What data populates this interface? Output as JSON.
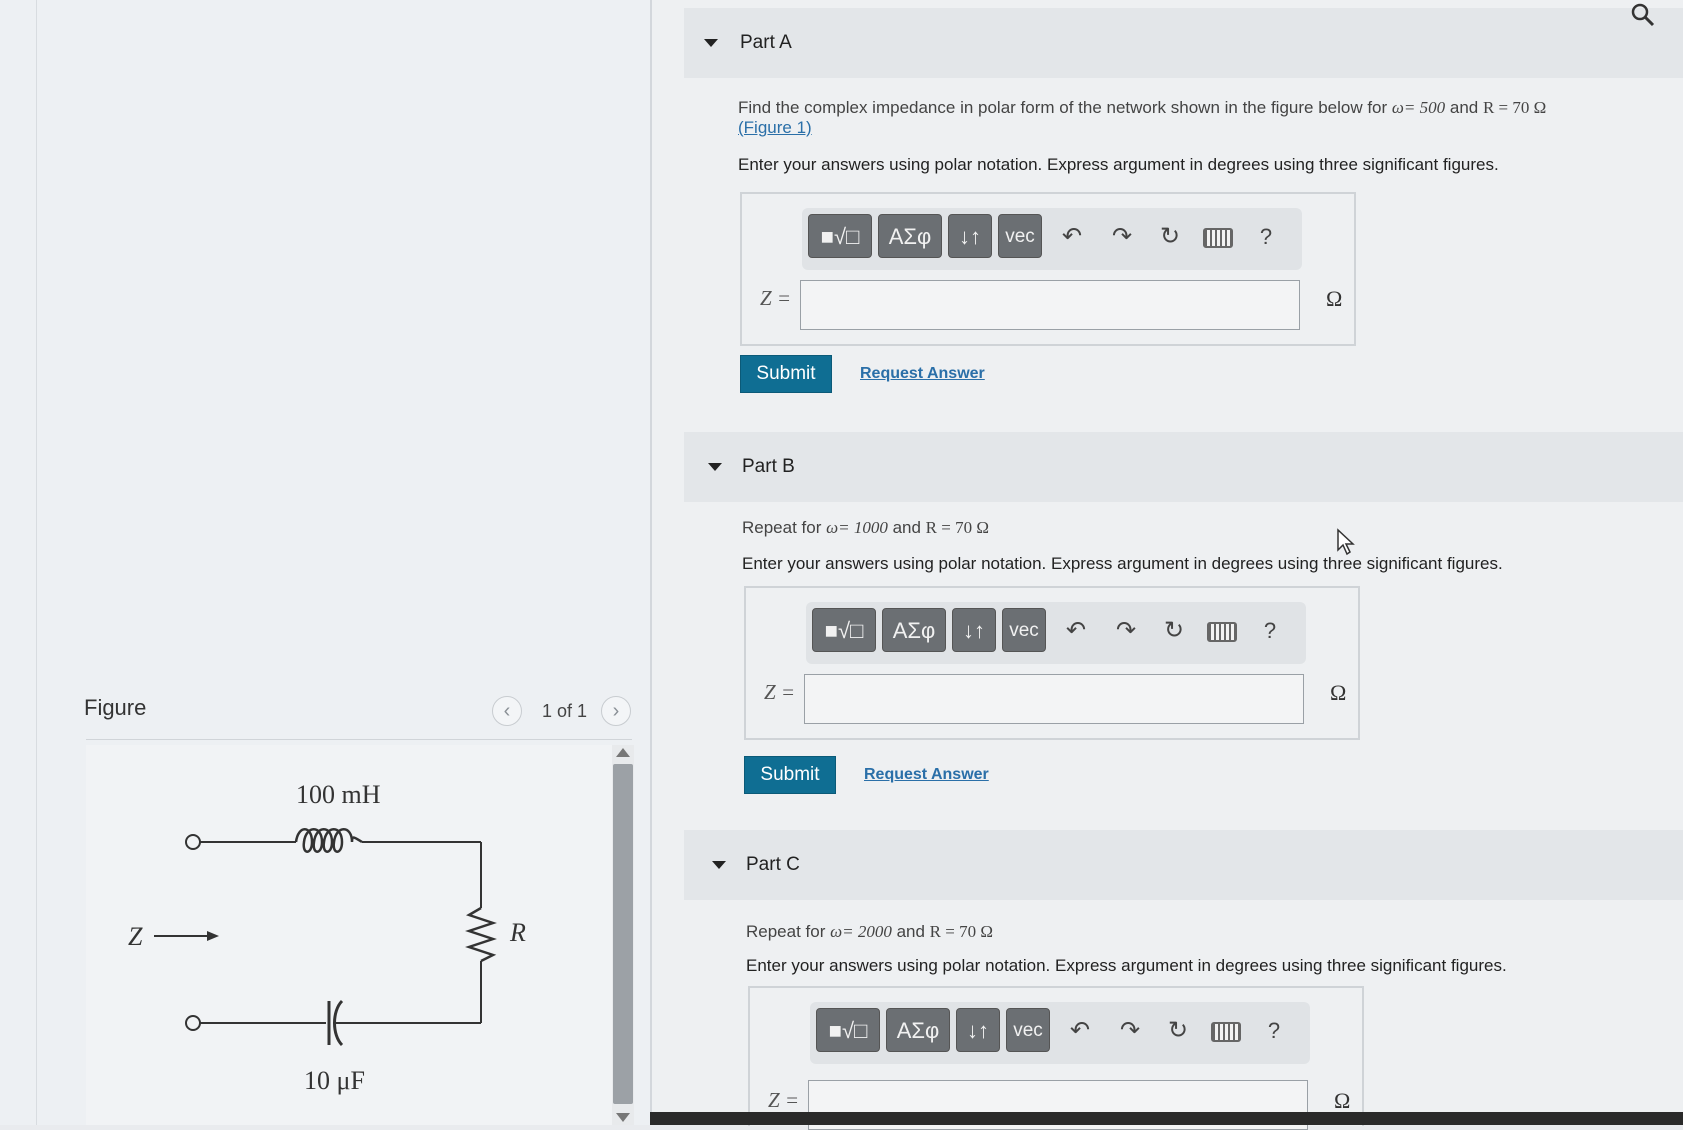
{
  "figure": {
    "label": "Figure",
    "counter": "1 of 1",
    "prev_icon": "‹",
    "next_icon": "›",
    "circuit": {
      "inductor_label": "100 mH",
      "capacitor_label": "10 μF",
      "resistor_label": "R",
      "z_label": "Z"
    }
  },
  "toolbar": {
    "templates_icon": "■√□",
    "greek_label": "ΑΣφ",
    "arrows_label": "↓↑",
    "vec_label": "vec",
    "undo_icon": "↶",
    "redo_icon": "↷",
    "reset_icon": "↻",
    "help_label": "?"
  },
  "parts": [
    {
      "title": "Part A",
      "prompt_prefix": "Find the complex impedance in polar form of the network shown in the figure below for ",
      "omega_expr": "ω= 500",
      "and_text": " and ",
      "r_expr": "R = 70 Ω",
      "figure_link": "(Figure 1)",
      "instruction": "Enter your answers using polar notation. Express argument in degrees using three significant figures.",
      "z_label": "Z =",
      "z_value": "",
      "unit": "Ω",
      "submit_label": "Submit",
      "request_label": "Request Answer"
    },
    {
      "title": "Part B",
      "prompt_prefix": "Repeat for ",
      "omega_expr": "ω= 1000",
      "and_text": " and ",
      "r_expr": "R = 70 Ω",
      "instruction": "Enter your answers using polar notation. Express argument in degrees using three significant figures.",
      "z_label": "Z =",
      "z_value": "",
      "unit": "Ω",
      "submit_label": "Submit",
      "request_label": "Request Answer"
    },
    {
      "title": "Part C",
      "prompt_prefix": "Repeat for ",
      "omega_expr": "ω= 2000",
      "and_text": " and ",
      "r_expr": "R = 70 Ω",
      "instruction": "Enter your answers using polar notation. Express argument in degrees using three significant figures.",
      "z_label": "Z =",
      "z_value": "",
      "unit": "Ω"
    }
  ],
  "icons": {
    "search": "magnifier-icon",
    "cursor": "mouse-pointer-icon"
  }
}
